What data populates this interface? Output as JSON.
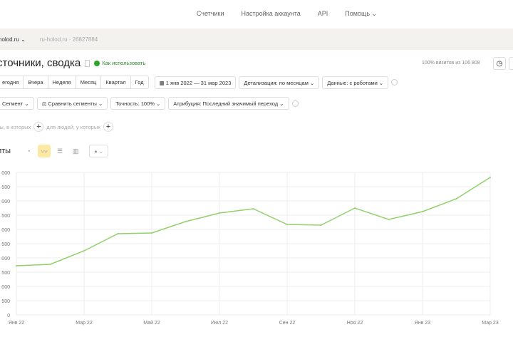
{
  "topnav": {
    "items": [
      "Счетчики",
      "Настройка аккаунта",
      "API",
      "Помощь ⌄"
    ]
  },
  "counter": {
    "site": "holod.ru ⌄",
    "sub": "ru-holod.ru · 26827884"
  },
  "header": {
    "title": "сточники, сводка",
    "howto": "Как использовать",
    "visits": "100% визитов из 106 808"
  },
  "periods": [
    "егодня",
    "Вчера",
    "Неделя",
    "Месяц",
    "Квартал",
    "Год"
  ],
  "date_range": "1 янв 2022 — 31 мар 2023",
  "detail": "Детализация: по месяцам ⌄",
  "data_mode": "Данные: с роботами ⌄",
  "segment": "Сегмент ⌄",
  "compare": "Сравнить сегменты ⌄",
  "accuracy": "Точность: 100% ⌄",
  "attribution": "Атрибуция: Последний значимый переход ⌄",
  "filters": {
    "visits_where": "ты, в которых",
    "people_where": "для людей, у которых"
  },
  "view": {
    "title": "иты",
    "menu": "⌄"
  },
  "chart_data": {
    "type": "line",
    "categories": [
      "Янв 22",
      "Фев 22",
      "Мар 22",
      "Апр 22",
      "Май 22",
      "Июн 22",
      "Июл 22",
      "Авг 22",
      "Сен 22",
      "Окт 22",
      "Ноя 22",
      "Дек 22",
      "Янв 23",
      "Фев 23",
      "Мар 23"
    ],
    "x_tick_labels": [
      "Янв 22",
      "Мар 22",
      "Май 22",
      "Июл 22",
      "Сен 22",
      "Ноя 22",
      "Янв 23",
      "Мар 23"
    ],
    "y_tick_labels": [
      "0",
      "500",
      "1 000",
      "1 500",
      "2 000",
      "2 500",
      "3 000",
      "3 500",
      "4 000",
      "4 500",
      "5 000"
    ],
    "ylim": [
      0,
      5000
    ],
    "series": [
      {
        "name": "Визиты",
        "color": "#8fd16a",
        "values": [
          1725,
          1775,
          2250,
          2850,
          2875,
          3275,
          3575,
          3725,
          3175,
          3150,
          3750,
          3350,
          3625,
          4075,
          4825
        ]
      }
    ],
    "grid": true
  }
}
